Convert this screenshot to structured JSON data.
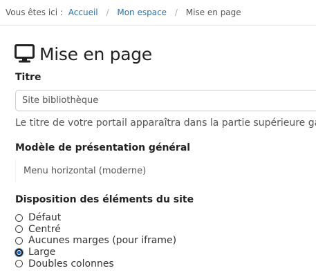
{
  "breadcrumb": {
    "prefix": "Vous êtes ici :",
    "items": [
      {
        "label": "Accueil"
      },
      {
        "label": "Mon espace"
      },
      {
        "label": "Mise en page"
      }
    ],
    "separator": "/"
  },
  "header": {
    "icon": "monitor-icon",
    "title": "Mise en page"
  },
  "form": {
    "title_field": {
      "label": "Titre",
      "value": "Site bibliothèque",
      "help": "Le titre de votre portail apparaîtra dans la partie supérieure ga"
    },
    "layout_model": {
      "label": "Modèle de présentation général",
      "selected": "Menu horizontal (moderne)"
    },
    "site_layout": {
      "label": "Disposition des éléments du site",
      "options": [
        {
          "label": "Défaut",
          "checked": false
        },
        {
          "label": "Centré",
          "checked": false
        },
        {
          "label": "Aucunes marges (pour iframe)",
          "checked": false
        },
        {
          "label": "Large",
          "checked": true
        },
        {
          "label": "Doubles colonnes",
          "checked": false
        }
      ]
    }
  },
  "colors": {
    "link": "#1e73be",
    "radio_selected": "#0a61c8"
  }
}
